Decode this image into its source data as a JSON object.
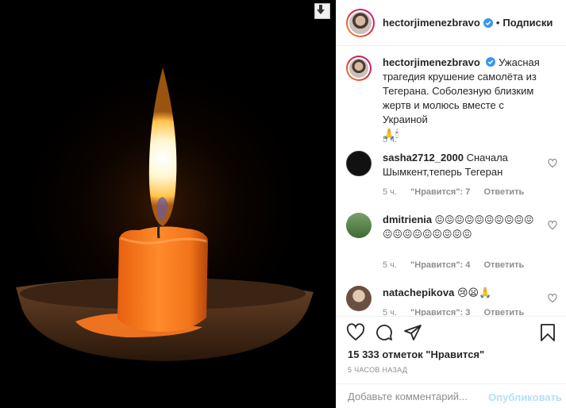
{
  "post": {
    "author": "hectorjimenezbravo",
    "follow_separator": "•",
    "follow_label": "Подписки",
    "caption": "Ужасная трагедия крушение самолёта из Тегерана. Соболезную близким жертв и молюсь вместе с Украиной",
    "caption_emoji": "🙏🕯",
    "caption_time": "5 ч."
  },
  "comments": [
    {
      "user": "sasha2712_2000",
      "text": "Сначала Шымкент,теперь Тегеран",
      "time": "5 ч.",
      "likes": "\"Нравится\": 7",
      "reply": "Ответить"
    },
    {
      "user": "dmitrienia",
      "text": "😖😖😖😖😖😖😖😖😖😖😖😖😖😖😖😖😖😖😖",
      "time": "5 ч.",
      "likes": "\"Нравится\": 4",
      "reply": "Ответить"
    },
    {
      "user": "natachepikova",
      "text": "😢😦🙏",
      "time": "5 ч.",
      "likes": "\"Нравится\": 3",
      "reply": "Ответить"
    }
  ],
  "actions": {
    "likes_count": "15 333 отметок \"Нравится\"",
    "time_ago": "5 ЧАСОВ НАЗАД",
    "comment_placeholder": "Добавьте комментарий...",
    "publish_label": "Опубликовать"
  },
  "icons": [
    "download-icon",
    "verified-badge-icon",
    "heart-icon",
    "comment-icon",
    "share-icon",
    "bookmark-icon"
  ],
  "colors": {
    "verified": "#3897f0",
    "publish_disabled": "#b2dffc",
    "muted": "#8e8e8e"
  }
}
